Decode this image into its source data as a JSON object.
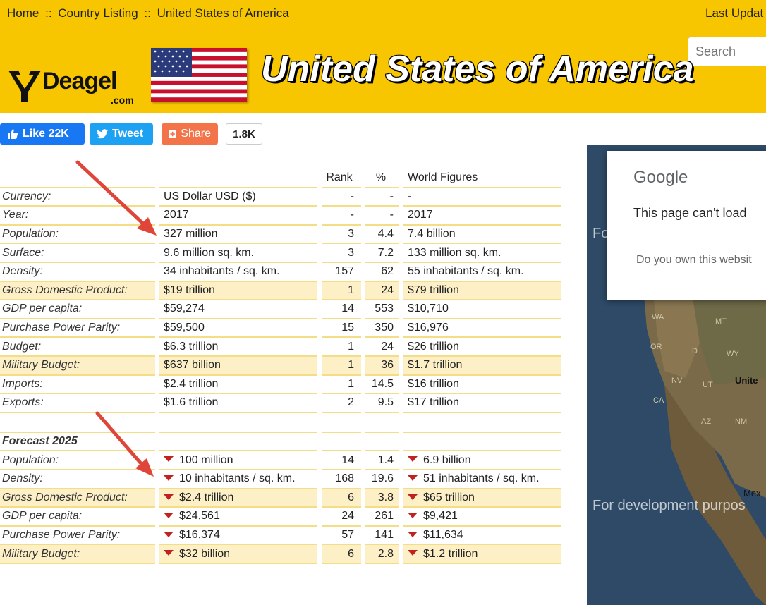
{
  "breadcrumb": {
    "home": "Home",
    "sep": "::",
    "listing": "Country Listing",
    "current": "United States of America"
  },
  "header": {
    "last_update": "Last Updat",
    "search_placeholder": "Search",
    "title": "United States of America",
    "logo_text": "Deagel",
    "logo_suffix": ".com"
  },
  "social": {
    "like_label": "Like 22K",
    "tweet_label": "Tweet",
    "share_label": "Share",
    "share_count": "1.8K"
  },
  "table": {
    "headers": {
      "label": "",
      "value": "",
      "rank": "Rank",
      "pct": "%",
      "world": "World Figures"
    },
    "rows": [
      {
        "label": "Currency:",
        "value": "US Dollar USD ($)",
        "rank": "-",
        "pct": "-",
        "world": "-",
        "hl": false
      },
      {
        "label": "Year:",
        "value": "2017",
        "rank": "-",
        "pct": "-",
        "world": "2017",
        "hl": false
      },
      {
        "label": "Population:",
        "value": "327 million",
        "rank": "3",
        "pct": "4.4",
        "world": "7.4 billion",
        "hl": false
      },
      {
        "label": "Surface:",
        "value": "9.6 million sq. km.",
        "rank": "3",
        "pct": "7.2",
        "world": "133 million sq. km.",
        "hl": false
      },
      {
        "label": "Density:",
        "value": "34 inhabitants / sq. km.",
        "rank": "157",
        "pct": "62",
        "world": "55 inhabitants / sq. km.",
        "hl": false
      },
      {
        "label": "Gross Domestic Product:",
        "value": "$19 trillion",
        "rank": "1",
        "pct": "24",
        "world": "$79 trillion",
        "hl": true
      },
      {
        "label": "GDP per capita:",
        "value": "$59,274",
        "rank": "14",
        "pct": "553",
        "world": "$10,710",
        "hl": false
      },
      {
        "label": "Purchase Power Parity:",
        "value": "$59,500",
        "rank": "15",
        "pct": "350",
        "world": "$16,976",
        "hl": false
      },
      {
        "label": "Budget:",
        "value": "$6.3 trillion",
        "rank": "1",
        "pct": "24",
        "world": "$26 trillion",
        "hl": false
      },
      {
        "label": "Military Budget:",
        "value": "$637 billion",
        "rank": "1",
        "pct": "36",
        "world": "$1.7 trillion",
        "hl": true
      },
      {
        "label": "Imports:",
        "value": "$2.4 trillion",
        "rank": "1",
        "pct": "14.5",
        "world": "$16 trillion",
        "hl": false
      },
      {
        "label": "Exports:",
        "value": "$1.6 trillion",
        "rank": "2",
        "pct": "9.5",
        "world": "$17 trillion",
        "hl": false
      }
    ],
    "forecast_title": "Forecast 2025",
    "forecast_rows": [
      {
        "label": "Population:",
        "value": "100 million",
        "rank": "14",
        "pct": "1.4",
        "world": "6.9 billion",
        "hl": false
      },
      {
        "label": "Density:",
        "value": "10 inhabitants / sq. km.",
        "rank": "168",
        "pct": "19.6",
        "world": "51 inhabitants / sq. km.",
        "hl": false
      },
      {
        "label": "Gross Domestic Product:",
        "value": "$2.4 trillion",
        "rank": "6",
        "pct": "3.8",
        "world": "$65 trillion",
        "hl": true
      },
      {
        "label": "GDP per capita:",
        "value": "$24,561",
        "rank": "24",
        "pct": "261",
        "world": "$9,421",
        "hl": false
      },
      {
        "label": "Purchase Power Parity:",
        "value": "$16,374",
        "rank": "57",
        "pct": "141",
        "world": "$11,634",
        "hl": false
      },
      {
        "label": "Military Budget:",
        "value": "$32 billion",
        "rank": "6",
        "pct": "2.8",
        "world": "$1.2 trillion",
        "hl": true
      }
    ]
  },
  "map": {
    "dialog_brand": "Google",
    "dialog_message": "This page can't load",
    "dialog_link": "Do you own this websit",
    "watermark": "For development purpos",
    "watermark_top": "Fo",
    "labels": [
      "WA",
      "MT",
      "OR",
      "ID",
      "WY",
      "NV",
      "UT",
      "Unite",
      "CA",
      "AZ",
      "NM",
      "Mex"
    ]
  },
  "colors": {
    "header_bg": "#f7c600",
    "row_highlight": "#fdf0c7",
    "row_border": "#f3dd86",
    "down_arrow": "#c0221f",
    "annotation_arrow": "#e0453a"
  }
}
